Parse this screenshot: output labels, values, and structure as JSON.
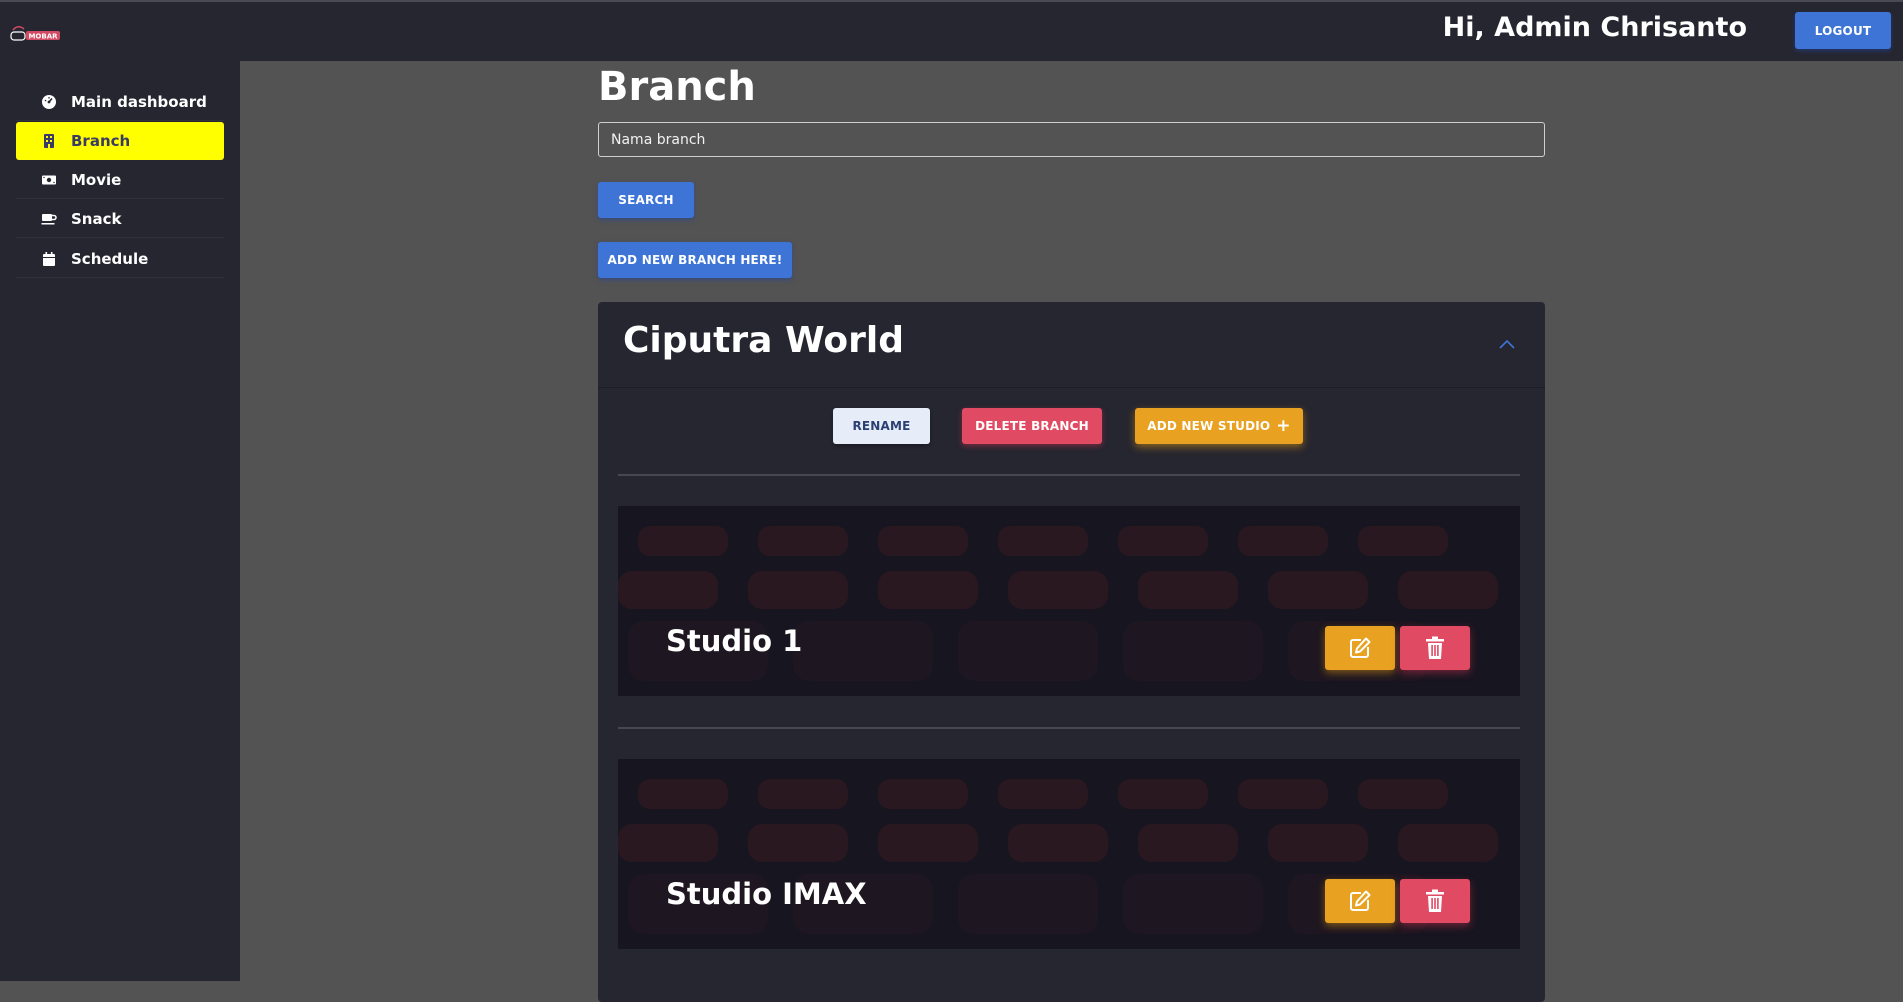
{
  "header": {
    "logo_text": "MOBAR",
    "greeting": "Hi, Admin Chrisanto",
    "logout_label": "LOGOUT"
  },
  "sidebar": {
    "items": [
      {
        "label": "Main dashboard",
        "icon": "gauge-icon",
        "active": false
      },
      {
        "label": "Branch",
        "icon": "building-icon",
        "active": true
      },
      {
        "label": "Movie",
        "icon": "ticket-icon",
        "active": false
      },
      {
        "label": "Snack",
        "icon": "mug-icon",
        "active": false
      },
      {
        "label": "Schedule",
        "icon": "calendar-icon",
        "active": false
      }
    ],
    "active_color": "#ffff00"
  },
  "main": {
    "title": "Branch",
    "search": {
      "placeholder": "Nama branch",
      "button_label": "SEARCH"
    },
    "add_branch_label": "ADD NEW BRANCH HERE!",
    "branch": {
      "name": "Ciputra World",
      "rename_label": "RENAME",
      "delete_label": "DELETE BRANCH",
      "add_studio_label": "ADD NEW STUDIO",
      "add_studio_icon": "plus-icon",
      "collapse_icon": "chevron-up-icon",
      "studios": [
        {
          "name": "Studio 1",
          "edit_icon": "edit-icon",
          "delete_icon": "trash-icon"
        },
        {
          "name": "Studio IMAX",
          "edit_icon": "edit-icon",
          "delete_icon": "trash-icon"
        }
      ]
    }
  },
  "colors": {
    "primary_blue": "#3d74d6",
    "danger_red": "#e04a63",
    "warning_orange": "#e8a120",
    "panel_dark": "#262630",
    "page_gray": "#535353"
  }
}
